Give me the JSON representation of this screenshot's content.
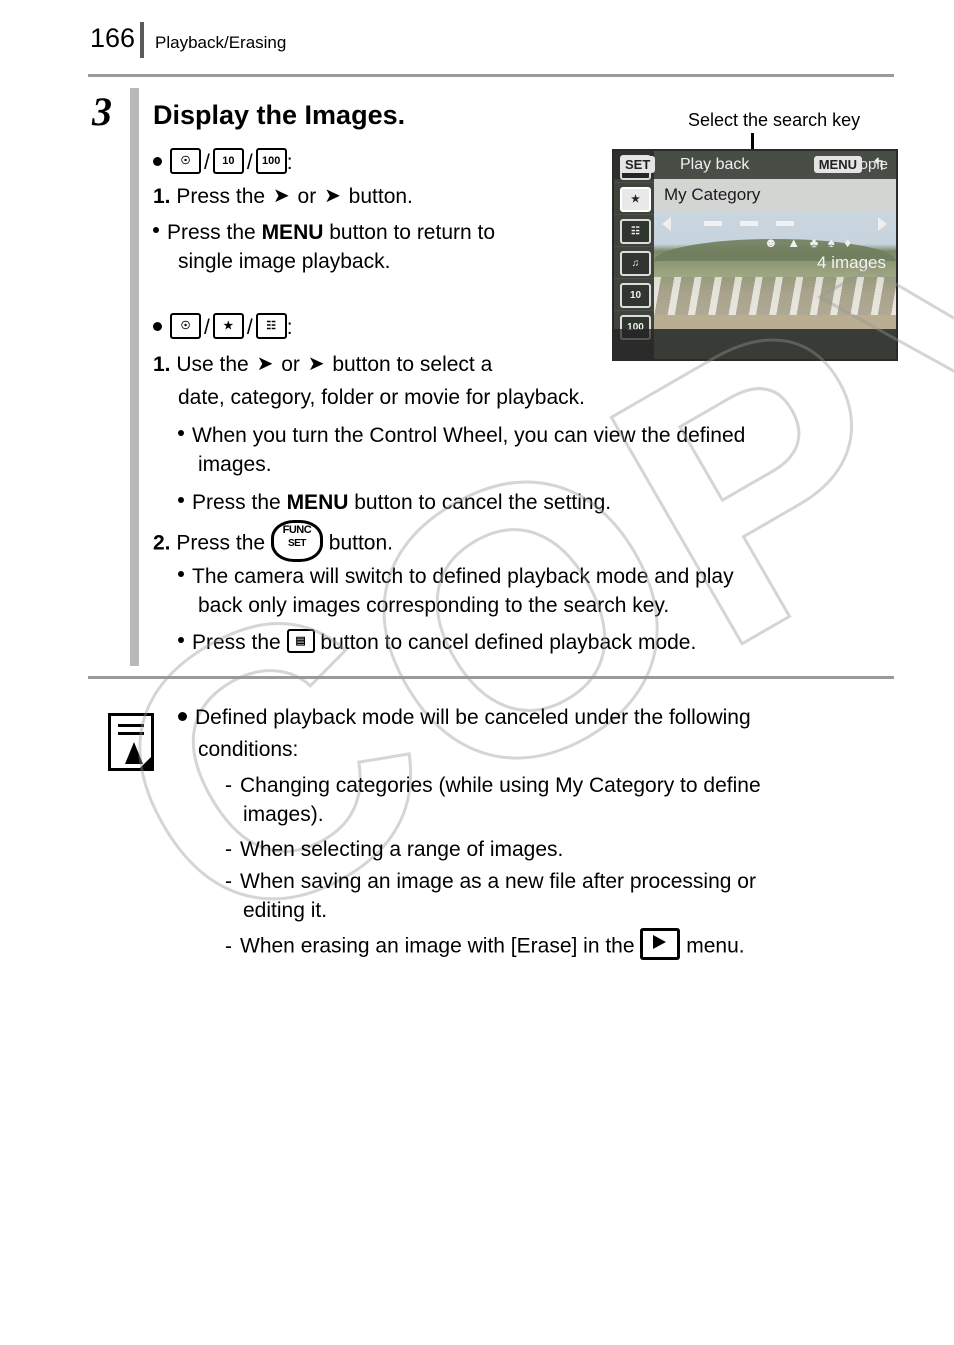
{
  "header": {
    "page_number": "166",
    "section_title": "Playback/Erasing"
  },
  "step": {
    "number": "3",
    "title": "Display the Images."
  },
  "callout": {
    "label": "Select the search key"
  },
  "lcd": {
    "mode_label": "People",
    "category_label": "My Category",
    "count_label": "4 images",
    "set_badge": "SET",
    "playback_label": "Play back",
    "menu_badge": "MENU",
    "back_glyph": "↰",
    "left_items": [
      {
        "glyph": "☉",
        "selected": false
      },
      {
        "glyph": "★",
        "selected": true
      },
      {
        "glyph": "☷",
        "selected": false
      },
      {
        "glyph": "♫",
        "selected": false
      },
      {
        "glyph": "10",
        "selected": false
      },
      {
        "glyph": "100",
        "selected": false
      }
    ]
  },
  "body": {
    "group1": {
      "icons": [
        "jump-date-icon",
        "jump-10-icon",
        "jump-100-icon"
      ],
      "icon_labels": [
        "☉",
        "10",
        "100"
      ],
      "colon": ":",
      "line1_num": "1.",
      "line1_a": "Press the",
      "line1_b": "or",
      "line1_c": "button.",
      "line2_a": "Press the",
      "line2_bold": "MENU",
      "line2_b": "button to return to",
      "line3": "single image playback."
    },
    "group2": {
      "icon_labels": [
        "☉",
        "★",
        "☷"
      ],
      "colon": ":",
      "line1_num": "1.",
      "line1_a": "Use the",
      "line1_b": "or",
      "line1_c": "button to select a",
      "line2": "date, category, folder or movie for playback.",
      "sub1": "When you turn the Control Wheel, you can view the defined",
      "sub1b": "images.",
      "sub2_a": "Press the",
      "sub2_bold": "MENU",
      "sub2_b": "button to cancel the setting.",
      "line3_num": "2.",
      "line3_a": "Press the",
      "line3_b": "button.",
      "funcset_top": "FUNC",
      "funcset_bottom": "SET",
      "sub3a": "The camera will switch to defined playback mode and play",
      "sub3b": "back only images corresponding to the search key.",
      "sub4_a": "Press the",
      "sub4_b": "button to cancel defined playback mode."
    }
  },
  "note": {
    "line1": "Defined playback mode will be canceled under the following",
    "line2": "conditions:",
    "items": [
      {
        "a": "Changing categories (while using My Category to define",
        "b": "images)."
      },
      {
        "a": "When selecting a range of images.",
        "b": ""
      },
      {
        "a": "When saving an image as a new file after processing or",
        "b": "editing it."
      }
    ],
    "last_a": "When erasing an image with [Erase] in the",
    "last_b": "menu."
  },
  "watermark": {
    "text": "COPY"
  },
  "colors": {
    "rule": "#9a9a9a",
    "step_bar": "#b9b9b9",
    "lcd_bg": "#6f7a6a"
  }
}
